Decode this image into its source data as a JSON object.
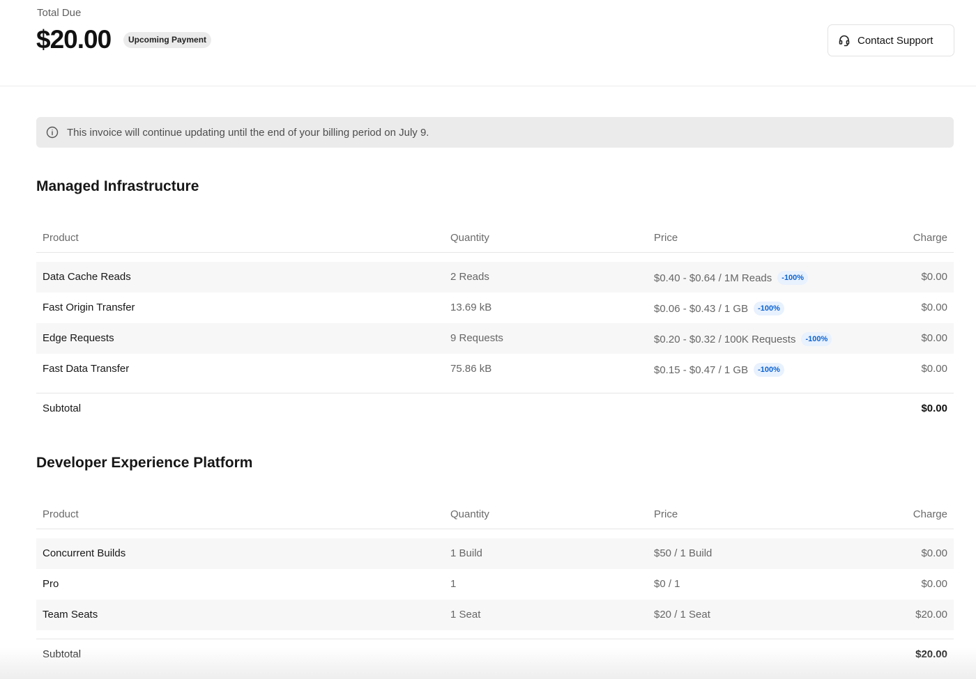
{
  "header": {
    "total_label": "Total Due",
    "total_amount": "$20.00",
    "status_badge": "Upcoming Payment",
    "contact_button": "Contact Support"
  },
  "notice": {
    "text": "This invoice will continue updating until the end of your billing period on July 9."
  },
  "columns": {
    "product": "Product",
    "quantity": "Quantity",
    "price": "Price",
    "charge": "Charge"
  },
  "sections": [
    {
      "title": "Managed Infrastructure",
      "rows": [
        {
          "product": "Data Cache Reads",
          "quantity": "2 Reads",
          "price": "$0.40 - $0.64 / 1M Reads",
          "discount": "-100%",
          "charge": "$0.00"
        },
        {
          "product": "Fast Origin Transfer",
          "quantity": "13.69 kB",
          "price": "$0.06 - $0.43 / 1 GB",
          "discount": "-100%",
          "charge": "$0.00"
        },
        {
          "product": "Edge Requests",
          "quantity": "9 Requests",
          "price": "$0.20 - $0.32 / 100K Requests",
          "discount": "-100%",
          "charge": "$0.00"
        },
        {
          "product": "Fast Data Transfer",
          "quantity": "75.86 kB",
          "price": "$0.15 - $0.47 / 1 GB",
          "discount": "-100%",
          "charge": "$0.00"
        }
      ],
      "subtotal_label": "Subtotal",
      "subtotal_value": "$0.00"
    },
    {
      "title": "Developer Experience Platform",
      "rows": [
        {
          "product": "Concurrent Builds",
          "quantity": "1 Build",
          "price": "$50 / 1 Build",
          "charge": "$0.00"
        },
        {
          "product": "Pro",
          "quantity": "1",
          "price": "$0 / 1",
          "charge": "$0.00"
        },
        {
          "product": "Team Seats",
          "quantity": "1 Seat",
          "price": "$20 / 1 Seat",
          "charge": "$20.00"
        }
      ],
      "subtotal_label": "Subtotal",
      "subtotal_value": "$20.00"
    }
  ],
  "icons": {
    "contact": "headset-icon",
    "notice": "info-icon"
  },
  "colors": {
    "discount_badge_text": "#0a63d1",
    "discount_badge_bg": "#e8f1fe",
    "notice_bg": "#ebebeb"
  }
}
